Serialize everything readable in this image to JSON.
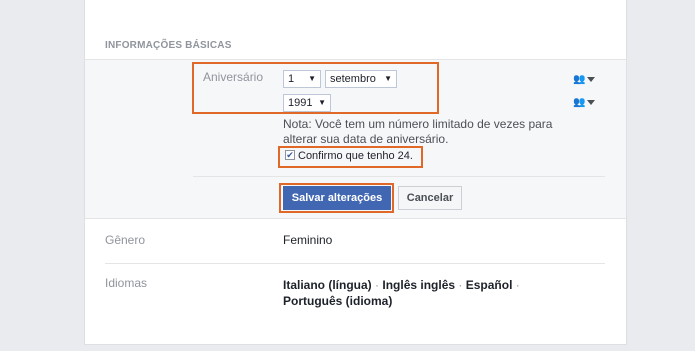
{
  "section": {
    "title": "INFORMAÇÕES BÁSICAS"
  },
  "birthday": {
    "label": "Aniversário",
    "day": "1",
    "month": "setembro",
    "year": "1991",
    "note": "Nota: Você tem um número limitado de vezes para alterar sua data de aniversário.",
    "confirm_label": "Confirmo que tenho 24.",
    "confirm_checked": true,
    "audience_icon": "people-icon"
  },
  "actions": {
    "save_label": "Salvar alterações",
    "cancel_label": "Cancelar"
  },
  "gender": {
    "label": "Gênero",
    "value": "Feminino"
  },
  "languages": {
    "label": "Idiomas",
    "items": [
      "Italiano (língua)",
      "Inglês inglês",
      "Español",
      "Português (idioma)"
    ]
  },
  "colors": {
    "highlight": "#e0692a",
    "primary_button": "#4267b2",
    "edit_background": "#f6f7f9"
  }
}
